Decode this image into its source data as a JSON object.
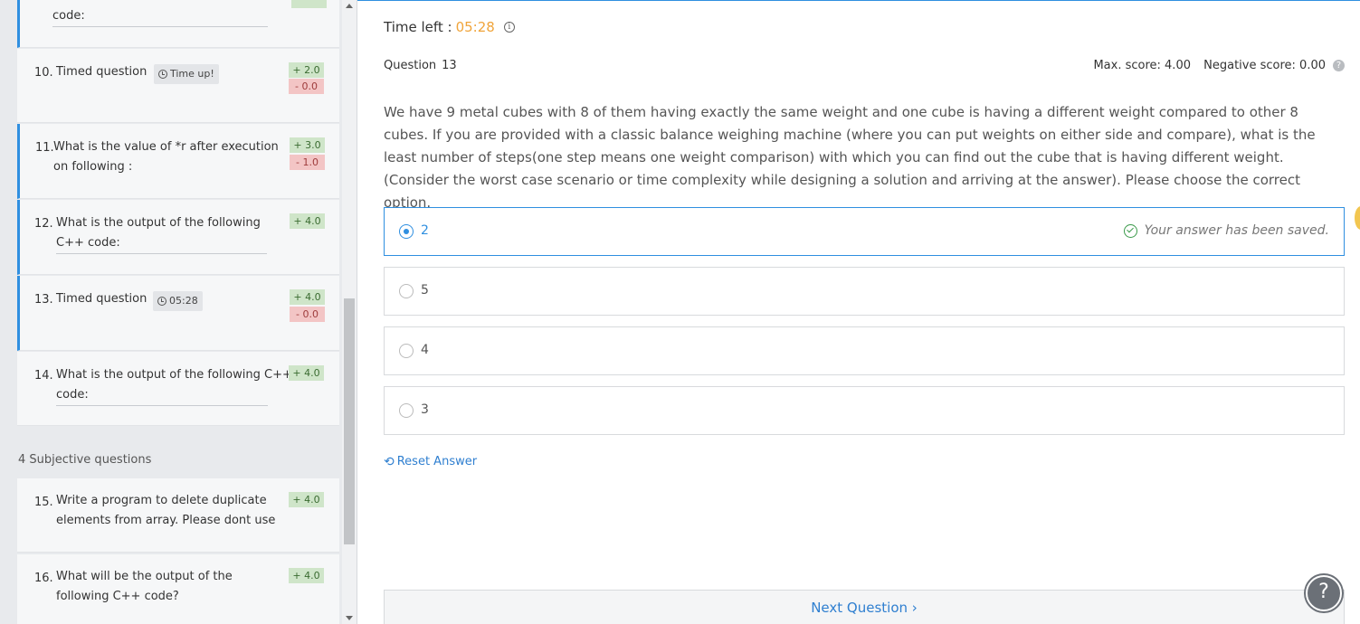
{
  "sidebar": {
    "partial_item": {
      "title": "code:"
    },
    "items": [
      {
        "num": "10.",
        "title": "Timed question",
        "tag": "Time up!",
        "pos": "+ 2.0",
        "neg": "- 0.0"
      },
      {
        "num": "11.",
        "title_line1": "What is the value of *r after execution",
        "title_line2": "on following :",
        "pos": "+ 3.0",
        "neg": "- 1.0"
      },
      {
        "num": "12.",
        "title_line1": "What is the output of the following",
        "title_line2": "C++ code:",
        "pos": "+ 4.0"
      },
      {
        "num": "13.",
        "title": "Timed question",
        "tag": "05:28",
        "pos": "+ 4.0",
        "neg": "- 0.0"
      },
      {
        "num": "14.",
        "title_line1": "What is the output of the following C++",
        "title_line2": "code:",
        "pos": "+ 4.0"
      }
    ],
    "section_label": "4 Subjective questions",
    "subjective": [
      {
        "num": "15.",
        "title_line1": "Write a program to delete duplicate",
        "title_line2": "elements from array. Please dont use",
        "pos": "+ 4.0"
      },
      {
        "num": "16.",
        "title_line1": "What will be the output of the",
        "title_line2": "following C++ code?",
        "pos": "+ 4.0"
      }
    ]
  },
  "main": {
    "timer_label": "Time left :",
    "timer_value": "05:28",
    "info_icon": "i",
    "question_label": "Question",
    "question_number": "13",
    "max_score": "Max. score: 4.00",
    "negative_score": "Negative score: 0.00",
    "help_small": "?",
    "question_text": "We have 9 metal cubes with 8 of them having exactly the same weight and one cube is having a different weight compared to other 8 cubes. If you are provided with a classic balance weighing machine (where you can put weights on either side and compare), what is the least number of steps(one step means one weight comparison) with which you can find out the cube that is having different weight.(Consider the worst case scenario or time complexity while designing a solution and arriving at the answer). Please choose the correct option.",
    "options": [
      {
        "value": "2",
        "selected": true
      },
      {
        "value": "5",
        "selected": false
      },
      {
        "value": "4",
        "selected": false
      },
      {
        "value": "3",
        "selected": false
      }
    ],
    "saved_message": "Your answer has been saved.",
    "reset_label": "Reset Answer",
    "next_label": "Next Question ›",
    "help_big": "?"
  },
  "colors": {
    "accent": "#2f8fe0",
    "timer": "#f0a43a",
    "positive": "#cfe5c9",
    "negative": "#f3c5c5"
  }
}
